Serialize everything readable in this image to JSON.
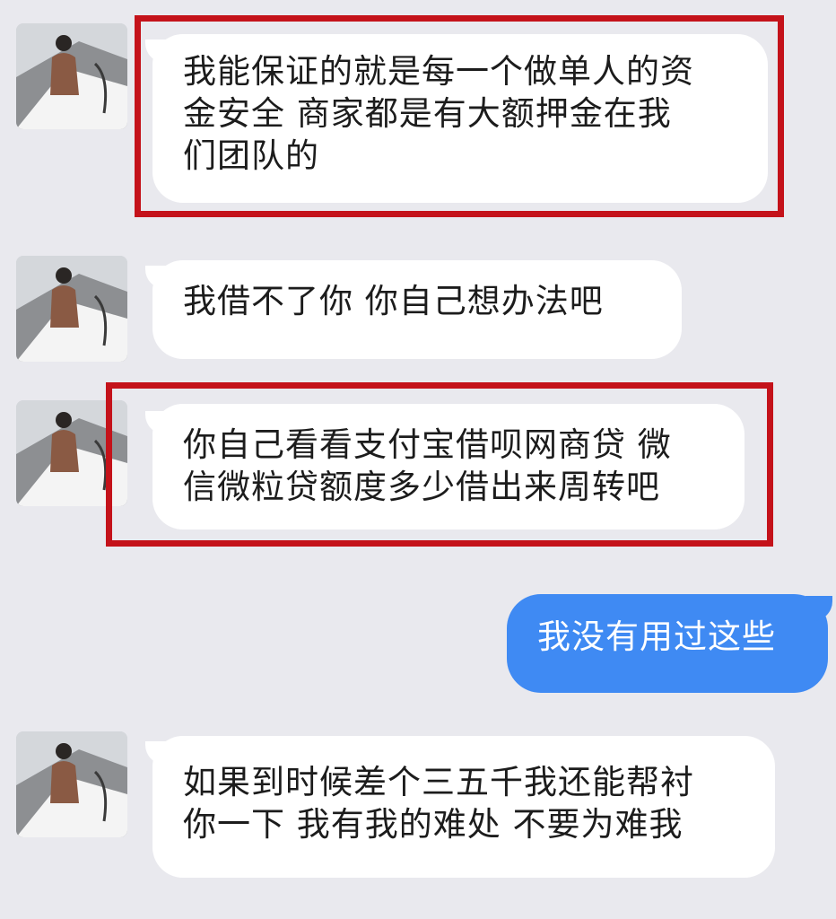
{
  "colors": {
    "background": "#e9e9ee",
    "incoming_bubble": "#ffffff",
    "outgoing_bubble": "#3f8af3",
    "highlight_border": "#c4121a"
  },
  "messages": [
    {
      "direction": "incoming",
      "highlighted": true,
      "lines": [
        "我能保证的就是每一个做单人的资",
        "金安全 商家都是有大额押金在我",
        "们团队的"
      ]
    },
    {
      "direction": "incoming",
      "highlighted": false,
      "lines": [
        "我借不了你 你自己想办法吧"
      ]
    },
    {
      "direction": "incoming",
      "highlighted": true,
      "lines": [
        "你自己看看支付宝借呗网商贷 微",
        "信微粒贷额度多少借出来周转吧"
      ]
    },
    {
      "direction": "outgoing",
      "highlighted": false,
      "lines": [
        "我没有用过这些"
      ]
    },
    {
      "direction": "incoming",
      "highlighted": false,
      "lines": [
        "如果到时候差个三五千我还能帮衬",
        "你一下 我有我的难处 不要为难我"
      ]
    }
  ],
  "avatar": {
    "icon": "contact-avatar-photo"
  }
}
